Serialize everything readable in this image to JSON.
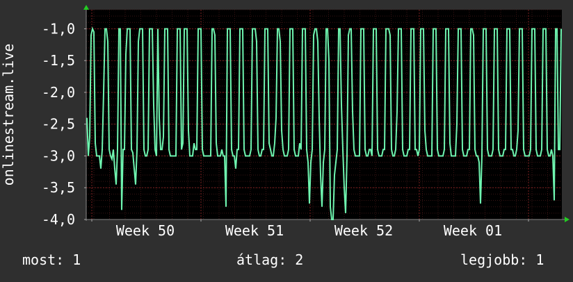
{
  "chart_data": {
    "type": "line",
    "ylabel": "onlinestream.live",
    "y_tick_labels": [
      "-1,0",
      "-1,5",
      "-2,0",
      "-2,5",
      "-3,0",
      "-3,5",
      "-4,0"
    ],
    "ylim": [
      -4.0,
      -0.7
    ],
    "x_tick_labels": [
      "Week 50",
      "Week 51",
      "Week 52",
      "Week 01"
    ],
    "grid": true,
    "colors": {
      "background": "#2f2f2f",
      "plot_background": "#000000",
      "grid": "#7a1f1f",
      "line": "#6ff5b0",
      "axis": "#666666",
      "arrow": "#22cc22"
    },
    "series": [
      {
        "values": [
          -2.4,
          -3.0,
          -2.7,
          -1.1,
          -1.0,
          -1.05,
          -2.8,
          -3.0,
          -3.0,
          -3.0,
          -3.2,
          -2.9,
          -2.0,
          -1.0,
          -1.0,
          -1.2,
          -2.9,
          -3.0,
          -3.05,
          -2.9,
          -3.2,
          -3.45,
          -2.9,
          -1.0,
          -1.0,
          -3.85,
          -2.9,
          -2.9,
          -1.4,
          -1.0,
          -1.0,
          -1.0,
          -2.9,
          -2.95,
          -3.2,
          -3.45,
          -2.9,
          -1.2,
          -1.0,
          -1.0,
          -1.0,
          -2.9,
          -3.0,
          -3.0,
          -2.9,
          -1.0,
          -1.0,
          -1.0,
          -2.2,
          -2.9,
          -3.0,
          -1.0,
          -2.4,
          -2.9,
          -2.9,
          -2.7,
          -1.0,
          -1.0,
          -1.0,
          -2.9,
          -3.0,
          -3.0,
          -3.0,
          -3.0,
          -3.0,
          -1.0,
          -1.0,
          -1.0,
          -2.9,
          -2.8,
          -1.0,
          -1.0,
          -1.0,
          -2.6,
          -3.0,
          -3.0,
          -3.0,
          -2.8,
          -2.9,
          -2.9,
          -1.0,
          -1.0,
          -1.0,
          -2.9,
          -3.0,
          -3.0,
          -3.0,
          -3.0,
          -3.0,
          -3.0,
          -1.0,
          -1.0,
          -1.1,
          -2.8,
          -3.0,
          -3.0,
          -3.0,
          -2.9,
          -3.0,
          -3.0,
          -3.8,
          -1.0,
          -1.0,
          -1.0,
          -2.9,
          -3.0,
          -3.0,
          -3.2,
          -2.9,
          -2.9,
          -1.0,
          -1.0,
          -1.0,
          -2.9,
          -3.0,
          -3.0,
          -3.0,
          -3.0,
          -2.9,
          -1.0,
          -1.0,
          -1.0,
          -1.2,
          -2.9,
          -3.0,
          -3.0,
          -2.9,
          -2.9,
          -1.0,
          -1.0,
          -1.0,
          -2.8,
          -2.9,
          -3.0,
          -3.0,
          -2.8,
          -2.4,
          -1.0,
          -1.0,
          -1.2,
          -2.6,
          -2.9,
          -3.0,
          -3.0,
          -3.0,
          -2.9,
          -1.0,
          -1.0,
          -1.0,
          -2.9,
          -3.0,
          -3.0,
          -3.0,
          -2.8,
          -2.9,
          -1.0,
          -1.0,
          -1.0,
          -2.9,
          -3.1,
          -3.75,
          -3.1,
          -2.9,
          -1.1,
          -1.0,
          -1.0,
          -1.2,
          -2.4,
          -3.3,
          -3.8,
          -3.1,
          -2.9,
          -1.0,
          -1.0,
          -1.5,
          -3.8,
          -4.0,
          -4.0,
          -3.3,
          -3.1,
          -2.9,
          -1.0,
          -1.0,
          -2.2,
          -2.9,
          -3.5,
          -3.9,
          -3.0,
          -1.1,
          -1.0,
          -1.0,
          -2.3,
          -2.9,
          -3.0,
          -3.0,
          -3.0,
          -3.0,
          -1.0,
          -1.0,
          -1.0,
          -2.9,
          -3.0,
          -3.0,
          -2.9,
          -2.9,
          -3.0,
          -1.0,
          -1.0,
          -1.0,
          -2.9,
          -3.0,
          -3.0,
          -3.0,
          -2.9,
          -2.9,
          -1.0,
          -1.0,
          -1.0,
          -1.1,
          -2.9,
          -3.0,
          -3.0,
          -2.9,
          -2.3,
          -1.0,
          -1.0,
          -1.0,
          -2.9,
          -3.0,
          -3.0,
          -3.0,
          -2.9,
          -2.9,
          -1.0,
          -1.0,
          -1.0,
          -2.9,
          -2.9,
          -3.0,
          -2.9,
          -1.0,
          -1.0,
          -1.0,
          -2.6,
          -2.9,
          -3.0,
          -3.0,
          -3.0,
          -3.0,
          -1.0,
          -1.0,
          -1.0,
          -2.9,
          -3.0,
          -3.0,
          -3.0,
          -3.0,
          -2.9,
          -1.0,
          -1.0,
          -1.0,
          -2.8,
          -3.0,
          -3.0,
          -3.0,
          -3.0,
          -2.5,
          -1.0,
          -1.0,
          -1.0,
          -2.9,
          -3.0,
          -3.0,
          -3.0,
          -2.9,
          -2.9,
          -1.0,
          -1.0,
          -1.1,
          -2.9,
          -3.0,
          -3.0,
          -3.1,
          -3.75,
          -3.0,
          -1.0,
          -1.0,
          -1.0,
          -2.9,
          -3.0,
          -3.0,
          -3.0,
          -2.9,
          -1.0,
          -1.0,
          -1.0,
          -2.9,
          -3.0,
          -3.0,
          -3.0,
          -2.9,
          -2.9,
          -1.0,
          -1.0,
          -1.0,
          -2.9,
          -2.9,
          -3.0,
          -3.0,
          -2.9,
          -2.6,
          -1.0,
          -1.0,
          -1.0,
          -2.9,
          -3.0,
          -3.0,
          -3.0,
          -3.0,
          -2.9,
          -1.0,
          -1.0,
          -1.0,
          -2.9,
          -3.0,
          -3.0,
          -3.0,
          -2.9,
          -1.0,
          -1.0,
          -1.0,
          -2.9,
          -3.0,
          -3.0,
          -2.9,
          -3.0,
          -3.7,
          -1.0,
          -1.0,
          -2.9,
          -2.9,
          -1.0
        ]
      }
    ]
  },
  "footer": {
    "current": "most: 1",
    "average": "átlag: 2",
    "best": "legjobb: 1"
  }
}
